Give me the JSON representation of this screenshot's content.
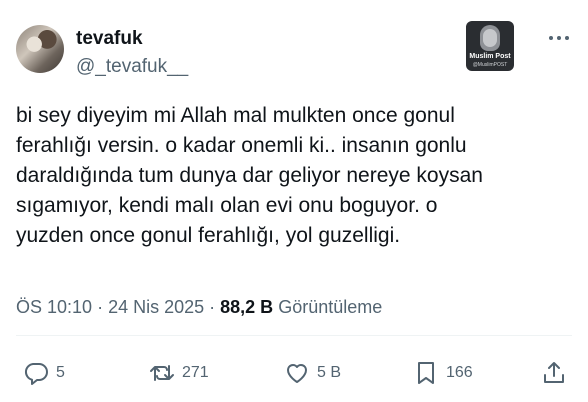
{
  "author": {
    "display_name": "tevafuk",
    "handle": "@_tevafuk__"
  },
  "badge": {
    "title": "Muslim Post",
    "handle": "@MuslimPOST"
  },
  "tweet": {
    "text": "bi sey diyeyim mi Allah mal mulkten once gonul\nferahlığı versin. o kadar onemli ki.. insanın gonlu\ndaraldığında tum dunya dar geliyor nereye koysan\nsıgamıyor, kendi malı olan evi onu boguyor. o\nyuzden once gonul ferahlığı, yol guzelligi."
  },
  "meta": {
    "time": "ÖS 10:10",
    "separator": " · ",
    "date": "24 Nis 2025",
    "views_count": "88,2 B",
    "views_label": "Görüntüleme"
  },
  "actions": {
    "replies": "5",
    "reposts": "271",
    "likes": "5 B",
    "bookmarks": "166"
  },
  "icons": [
    "reply-icon",
    "repost-icon",
    "like-icon",
    "bookmark-icon",
    "share-icon",
    "more-icon"
  ],
  "colors": {
    "text": "#0f1419",
    "secondary": "#536471",
    "divider": "#eff3f4"
  }
}
